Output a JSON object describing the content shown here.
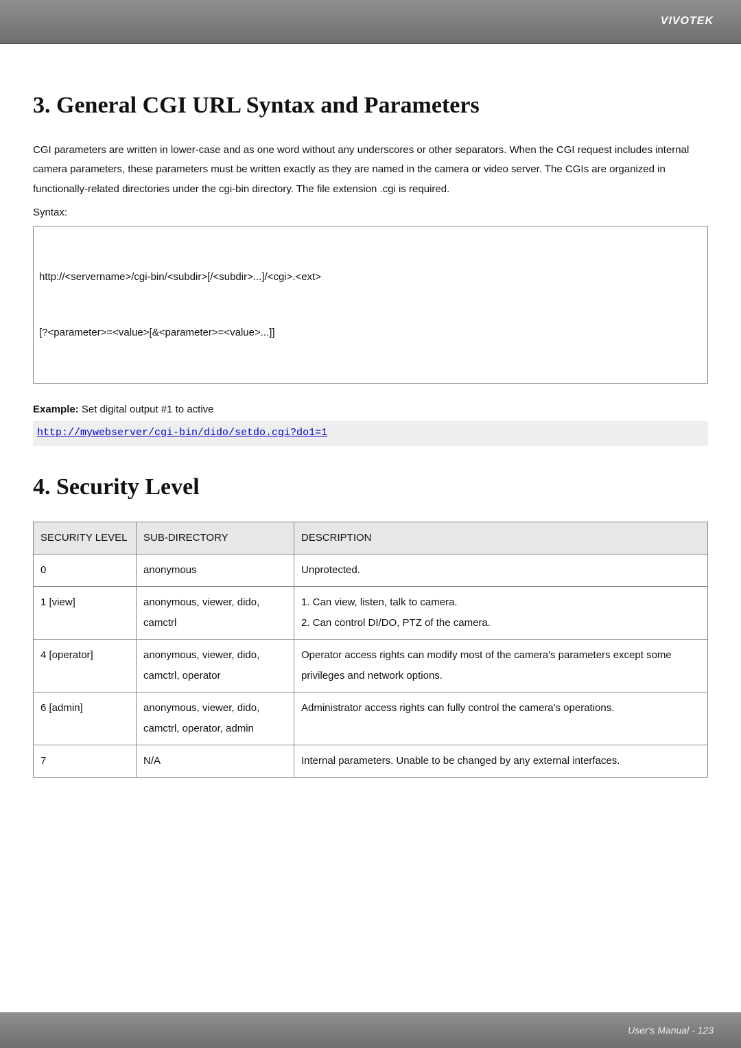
{
  "header": {
    "brand": "VIVOTEK"
  },
  "section3": {
    "title": "3. General CGI URL Syntax and Parameters",
    "paragraph": "CGI parameters are written in lower-case and as one word without any underscores or other separators. When the CGI request includes internal camera parameters, these parameters must be written exactly as they are named in the camera or video server. The CGIs are organized in functionally-related directories under the cgi-bin directory. The file extension .cgi is required.",
    "syntax_label": "Syntax:",
    "syntax_line1": "http://<servername>/cgi-bin/<subdir>[/<subdir>...]/<cgi>.<ext>",
    "syntax_line2": "[?<parameter>=<value>[&<parameter>=<value>...]]",
    "example_label_bold": "Example:",
    "example_label_rest": " Set digital output #1 to active",
    "example_url": "http://mywebserver/cgi-bin/dido/setdo.cgi?do1=1"
  },
  "section4": {
    "title": "4. Security Level",
    "headers": {
      "level": "SECURITY LEVEL",
      "subdir": "SUB-DIRECTORY",
      "desc": "DESCRIPTION"
    },
    "rows": [
      {
        "level": "0",
        "subdir": "anonymous",
        "desc": "Unprotected."
      },
      {
        "level": "1 [view]",
        "subdir": "anonymous, viewer, dido, camctrl",
        "desc": "1. Can view, listen, talk to camera.\n2. Can control DI/DO, PTZ of the camera."
      },
      {
        "level": "4 [operator]",
        "subdir": "anonymous, viewer, dido, camctrl, operator",
        "desc": "Operator access rights can modify most of the camera's parameters except some privileges and network options."
      },
      {
        "level": "6 [admin]",
        "subdir": "anonymous, viewer, dido, camctrl, operator, admin",
        "desc": "Administrator access rights can fully control the camera's operations."
      },
      {
        "level": "7",
        "subdir": "N/A",
        "desc": "Internal parameters. Unable to be changed by any external interfaces."
      }
    ]
  },
  "footer": {
    "text": "User's Manual - 123"
  }
}
